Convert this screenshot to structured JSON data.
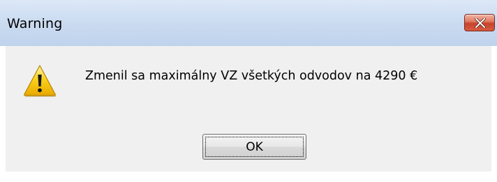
{
  "window": {
    "title": "Warning",
    "close_icon": "close-icon"
  },
  "dialog": {
    "icon": "warning-icon",
    "message": "Zmenil sa maximálny VZ všetkých odvodov na 4290 €",
    "ok_label": "OK"
  },
  "colors": {
    "titlebar": "#c9daf0",
    "close_button": "#c8442c",
    "content_bg": "#f0f0f0",
    "warning_yellow": "#f5c400"
  }
}
